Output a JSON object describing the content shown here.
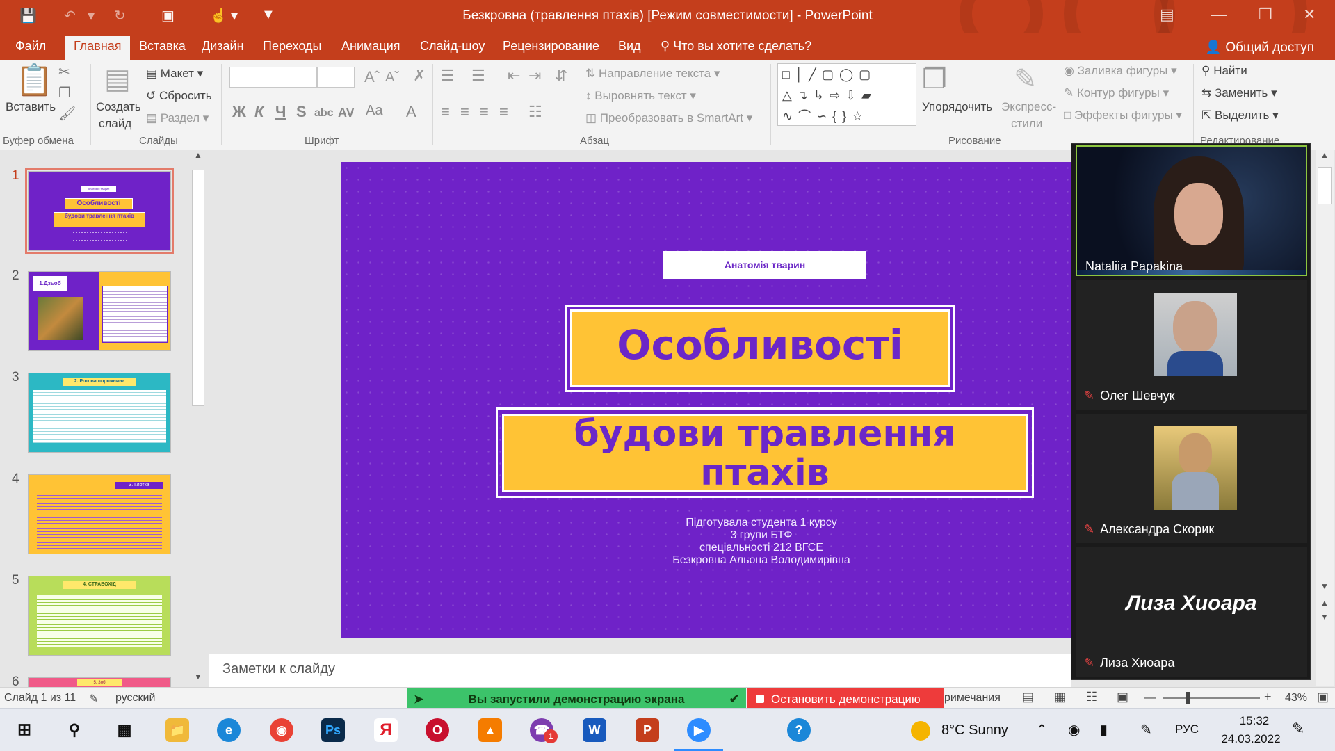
{
  "window": {
    "title": "Безкровна (травлення птахів) [Режим совместимости] - PowerPoint"
  },
  "tabs": [
    "Файл",
    "Главная",
    "Вставка",
    "Дизайн",
    "Переходы",
    "Анимация",
    "Слайд-шоу",
    "Рецензирование",
    "Вид"
  ],
  "tell_me": "Что вы хотите сделать?",
  "share_label": "Общий доступ",
  "ribbon": {
    "paste": "Вставить",
    "clipboard_group": "Буфер обмена",
    "new_slide_1": "Создать",
    "new_slide_2": "слайд",
    "layout": "Макет",
    "reset": "Сбросить",
    "section": "Раздел",
    "slides_group": "Слайды",
    "font_group": "Шрифт",
    "text_direction": "Направление текста",
    "align_text": "Выровнять текст",
    "smartart": "Преобразовать в SmartArt",
    "paragraph_group": "Абзац",
    "arrange": "Упорядочить",
    "quick_styles_1": "Экспресс-",
    "quick_styles_2": "стили",
    "shape_fill": "Заливка фигуры",
    "shape_outline": "Контур фигуры",
    "shape_effects": "Эффекты фигуры",
    "drawing_group": "Рисование",
    "find": "Найти",
    "replace": "Заменить",
    "select": "Выделить",
    "editing_group": "Редактирование"
  },
  "thumbnails": [
    {
      "num": "1",
      "caption": "Анатомія тварин",
      "title1": "Особливості",
      "title2": "будови травлення птахів"
    },
    {
      "num": "2",
      "caption": "1.Дзьоб"
    },
    {
      "num": "3",
      "caption": "2. Ротова порожнина"
    },
    {
      "num": "4",
      "caption": "3. Глотка"
    },
    {
      "num": "5",
      "caption": "4. СТРАВОХІД"
    },
    {
      "num": "6",
      "caption": "5. Зоб"
    }
  ],
  "slide": {
    "subject": "Анатомія тварин",
    "title1": "Особливості",
    "title2a": "будови травлення",
    "title2b": "птахів",
    "author_1": "Підготувала студента 1 курсу",
    "author_2": "3 групи БТФ",
    "author_3": "спеціальності 212 ВГСЕ",
    "author_4": "Безкровна Альона Володимирівна"
  },
  "notes_placeholder": "Заметки к слайду",
  "status": {
    "slide_count": "Слайд 1 из 11",
    "language": "русский",
    "sharing": "Вы запустили демонстрацию экрана",
    "stop_sharing": "Остановить демонстрацию",
    "comments": "римечания",
    "zoom": "43%"
  },
  "participants": [
    {
      "name": "Nataliia Papakina"
    },
    {
      "name": "Олег Шевчук"
    },
    {
      "name": "Александра Скорик"
    },
    {
      "name": "Лиза Хиоара"
    }
  ],
  "taskbar": {
    "weather": "8°C  Sunny",
    "lang": "РУС",
    "time": "15:32",
    "date": "24.03.2022",
    "notif": "1"
  },
  "colors": {
    "ppt_accent": "#c43e1c",
    "slide_bg": "#6f22c8",
    "slide_yellow": "#ffc335",
    "zoom_share_green": "#3cc36a",
    "zoom_stop_red": "#ee3b3b"
  }
}
